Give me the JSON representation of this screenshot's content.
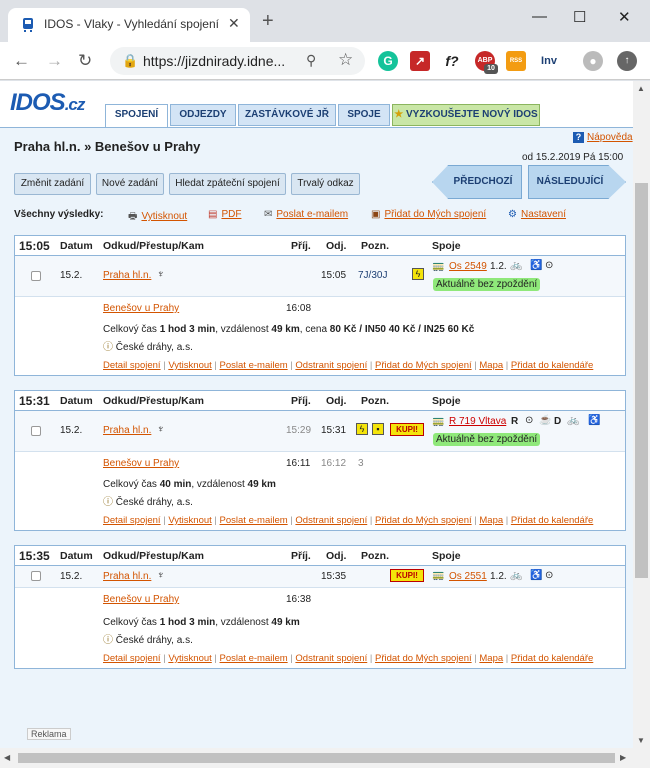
{
  "browser": {
    "tab_title": "IDOS - Vlaky - Vyhledání spojení",
    "url": "https://jizdnirady.idne..."
  },
  "extensions": {
    "grammarly": "G",
    "pdf": "↗",
    "formula": "f?",
    "abp": "ABP",
    "abp_count": "10",
    "rss": "RSS",
    "inv": "Inv"
  },
  "logo": {
    "main": "IDOS",
    "suffix": ".cz"
  },
  "nav": [
    "SPOJENÍ",
    "ODJEZDY",
    "ZASTÁVKOVÉ JŘ",
    "SPOJE",
    "VYZKOUŠEJTE NOVÝ IDOS"
  ],
  "help": "Nápověda",
  "route": "Praha hl.n. » Benešov u Prahy",
  "date_from": "od 15.2.2019 Pá 15:00",
  "buttons": {
    "change": "Změnit zadání",
    "new": "Nové zadání",
    "return": "Hledat zpáteční spojení",
    "permalink": "Trvalý odkaz",
    "prev": "PŘEDCHOZÍ",
    "next": "NÁSLEDUJÍCÍ"
  },
  "all_results": {
    "label": "Všechny výsledky:",
    "print": "Vytisknout",
    "pdf": "PDF",
    "email": "Poslat e-mailem",
    "save": "Přidat do Mých spojení",
    "settings": "Nastavení"
  },
  "headers": {
    "date": "Datum",
    "route": "Odkud/Přestup/Kam",
    "arr": "Příj.",
    "dep": "Odj.",
    "note": "Pozn.",
    "train": "Spoje"
  },
  "links": [
    "Detail spojení",
    "Vytisknout",
    "Poslat e-mailem",
    "Odstranit spojení",
    "Přidat do Mých spojení",
    "Mapa",
    "Přidat do kalendáře"
  ],
  "connections": [
    {
      "time": "15:05",
      "date": "15.2.",
      "from": "Praha hl.n.",
      "dep": "15:05",
      "platform": "7J/30J",
      "train": "Os 2549",
      "train_extra": "1.2.",
      "status": "Aktuálně bez zpoždění",
      "to": "Benešov u Prahy",
      "arr": "16:08",
      "summary_pre": "Celkový čas ",
      "summary_time": "1 hod 3 min",
      "summary_mid": ", vzdálenost ",
      "summary_dist": "49 km",
      "summary_post": ", cena ",
      "price": "80 Kč / IN50 40 Kč / IN25 60 Kč",
      "operator": "České dráhy, a.s."
    },
    {
      "time": "15:31",
      "date": "15.2.",
      "from": "Praha hl.n.",
      "arr_from": "15:29",
      "dep": "15:31",
      "kupi": "KUPI!",
      "train": "R 719 Vltava",
      "train_extra": "R",
      "status": "Aktuálně bez zpoždění",
      "to": "Benešov u Prahy",
      "arr": "16:11",
      "dep_to": "16:12",
      "platform_to": "3",
      "summary_pre": "Celkový čas ",
      "summary_time": "40 min",
      "summary_mid": ", vzdálenost ",
      "summary_dist": "49 km",
      "operator": "České dráhy, a.s."
    },
    {
      "time": "15:35",
      "date": "15.2.",
      "from": "Praha hl.n.",
      "dep": "15:35",
      "kupi": "KUPI!",
      "train": "Os 2551",
      "train_extra": "1.2.",
      "to": "Benešov u Prahy",
      "arr": "16:38",
      "summary_pre": "Celkový čas ",
      "summary_time": "1 hod 3 min",
      "summary_mid": ", vzdálenost ",
      "summary_dist": "49 km",
      "operator": "České dráhy, a.s."
    }
  ],
  "reklama": "Reklama"
}
